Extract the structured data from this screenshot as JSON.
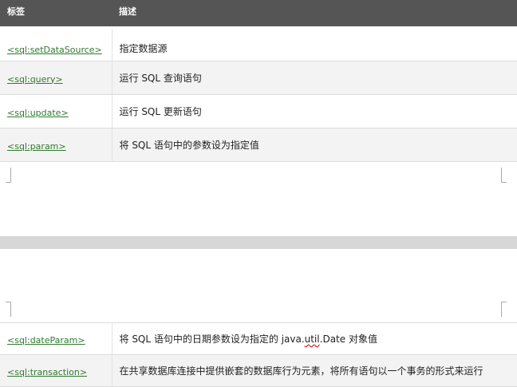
{
  "header": {
    "col_tag": "标签",
    "col_desc": "描述"
  },
  "rows_top": [
    {
      "tag": "<sql:setDataSource>",
      "desc": "指定数据源"
    },
    {
      "tag": "<sql:query>",
      "desc": "运行 SQL 查询语句"
    },
    {
      "tag": "<sql:update>",
      "desc": "运行 SQL 更新语句"
    },
    {
      "tag": "<sql:param>",
      "desc": "将 SQL 语句中的参数设为指定值"
    }
  ],
  "rows_bottom": [
    {
      "tag": "<sql:dateParam>",
      "desc_before": "将 SQL 语句中的日期参数设为指定的 java.",
      "desc_spell": "util",
      "desc_after": ".Date 对象值"
    },
    {
      "tag": "<sql:transaction>",
      "desc": "在共享数据库连接中提供嵌套的数据库行为元素，将所有语句以一个事务的形式来运行"
    }
  ]
}
